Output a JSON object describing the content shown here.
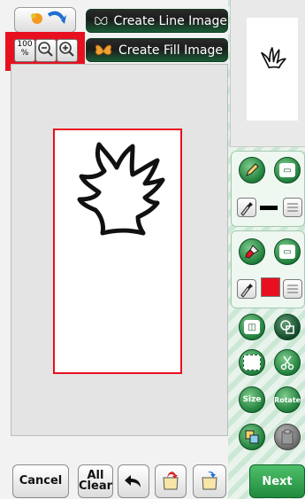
{
  "toolbar": {
    "create_line_label": "Create Line Image",
    "create_fill_label": "Create Fill Image",
    "zoom_100_label": "100\n%",
    "zoom_out_icon": "magnifier-minus",
    "zoom_in_icon": "magnifier-plus"
  },
  "line_tools": {
    "pen_icon": "pencil",
    "eraser_icon": "line-eraser",
    "eyedropper_icon": "eyedropper",
    "line_color": "#000000",
    "menu_icon": "list"
  },
  "fill_tools": {
    "brush_icon": "paint-brush",
    "eraser_icon": "fill-eraser",
    "eyedropper_icon": "eyedropper",
    "fill_color": "#e8101f",
    "menu_icon": "list"
  },
  "edit_tools": {
    "size_label": "Size",
    "rotate_label": "Rotate"
  },
  "bottom_bar": {
    "cancel_label": "Cancel",
    "all_clear_label": "All\nClear",
    "next_label": "Next"
  },
  "colors": {
    "accent_green": "#1e7e3a",
    "highlight_red": "#e8101f"
  }
}
